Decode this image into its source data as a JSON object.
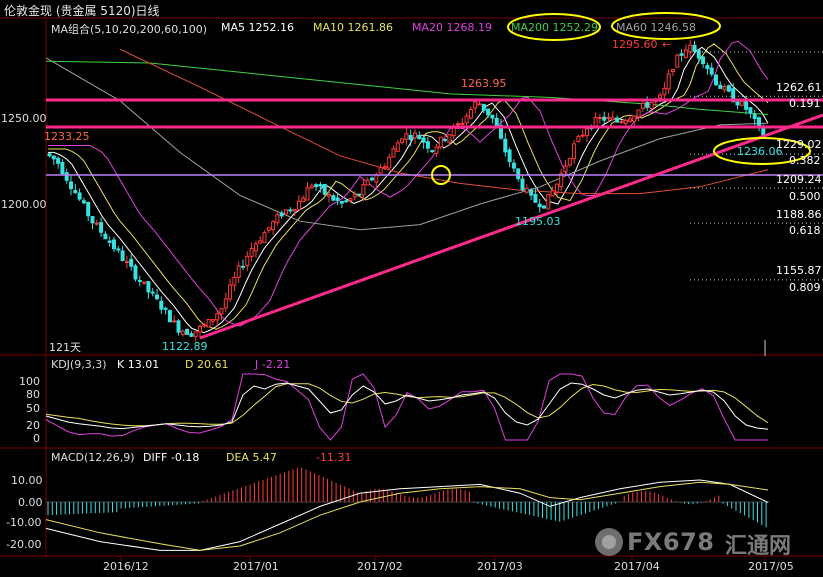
{
  "header": {
    "title": "伦敦金现 (贵金属 5120)日线"
  },
  "ma_legend": {
    "label": "MA组合(5,10,20,200,60,100)",
    "ma5": "MA5 1252.16",
    "ma10": "MA10 1261.86",
    "ma20": "MA20 1268.19",
    "ma200": "MA200 1252.29",
    "ma60": "MA60 1246.58"
  },
  "annotations": {
    "high_main": "1295.60",
    "high_main_arrow": "←",
    "peak_mid": "1263.95",
    "low_left": "1122.89",
    "low_mid": "1195.03",
    "current": "1236.06",
    "left_level": "1233.25",
    "days": "121天"
  },
  "fib_levels": [
    {
      "price": "1262.61",
      "ratio": "0.191"
    },
    {
      "price": "1229.02",
      "ratio": "0.382"
    },
    {
      "price": "1209.24",
      "ratio": "0.500"
    },
    {
      "price": "1188.86",
      "ratio": "0.618"
    },
    {
      "price": "1155.87",
      "ratio": "0.809"
    }
  ],
  "kdj_legend": {
    "label": "KDJ(9,3,3)",
    "k": "K   13.01",
    "d": "D   20.61",
    "j": "J   -2.21"
  },
  "macd_legend": {
    "label": "MACD(12,26,9)",
    "diff": "DIFF   -0.18",
    "dea": "DEA   5.47",
    "macd": "-11.31"
  },
  "watermark": {
    "text": "FX678",
    "cn": "汇通网"
  },
  "colors": {
    "up": "#ff3b3b",
    "down": "#38e0e0",
    "ma5": "#ffffff",
    "ma10": "#e8e05a",
    "ma20": "#e040e0",
    "ma200": "#40d040",
    "ma60": "#a0a0a0",
    "ma100": "#e05030",
    "trend": "#ff2a8c",
    "highlight": "#ffff00"
  },
  "chart_data": [
    {
      "type": "candlestick",
      "title": "伦敦金现 (贵金属 5120)日线",
      "x_tick_labels": [
        "2016/12",
        "2017/01",
        "2017/02",
        "2017/03",
        "2017/04",
        "2017/05"
      ],
      "y_tick_labels": [
        "1250.00",
        "1200.00"
      ],
      "ylim": [
        1110,
        1300
      ],
      "grid": false,
      "points": [
        {
          "label": "low",
          "value": 1122.89
        },
        {
          "label": "peak",
          "value": 1263.95
        },
        {
          "label": "pullback_low",
          "value": 1195.03
        },
        {
          "label": "high",
          "value": 1295.6
        },
        {
          "label": "current",
          "value": 1236.06
        }
      ],
      "series": [
        {
          "name": "MA5",
          "value": 1252.16
        },
        {
          "name": "MA10",
          "value": 1261.86
        },
        {
          "name": "MA20",
          "value": 1268.19
        },
        {
          "name": "MA200",
          "value": 1252.29
        },
        {
          "name": "MA60",
          "value": 1246.58
        }
      ],
      "fibonacci": [
        {
          "ratio": 0.191,
          "price": 1262.61
        },
        {
          "ratio": 0.382,
          "price": 1229.02
        },
        {
          "ratio": 0.5,
          "price": 1209.24
        },
        {
          "ratio": 0.618,
          "price": 1188.86
        },
        {
          "ratio": 0.809,
          "price": 1155.87
        }
      ]
    },
    {
      "type": "line",
      "title": "KDJ(9,3,3)",
      "y_tick_labels": [
        "100",
        "80",
        "50",
        "20",
        "0"
      ],
      "ylim": [
        -20,
        110
      ],
      "series": [
        {
          "name": "K",
          "value": 13.01
        },
        {
          "name": "D",
          "value": 20.61
        },
        {
          "name": "J",
          "value": -2.21
        }
      ]
    },
    {
      "type": "bar",
      "title": "MACD(12,26,9)",
      "y_tick_labels": [
        "10.00",
        "0.00",
        "-10.00",
        "-20.00"
      ],
      "ylim": [
        -25,
        18
      ],
      "series": [
        {
          "name": "DIFF",
          "value": -0.18
        },
        {
          "name": "DEA",
          "value": 5.47
        },
        {
          "name": "MACD",
          "value": -11.31
        }
      ]
    }
  ]
}
